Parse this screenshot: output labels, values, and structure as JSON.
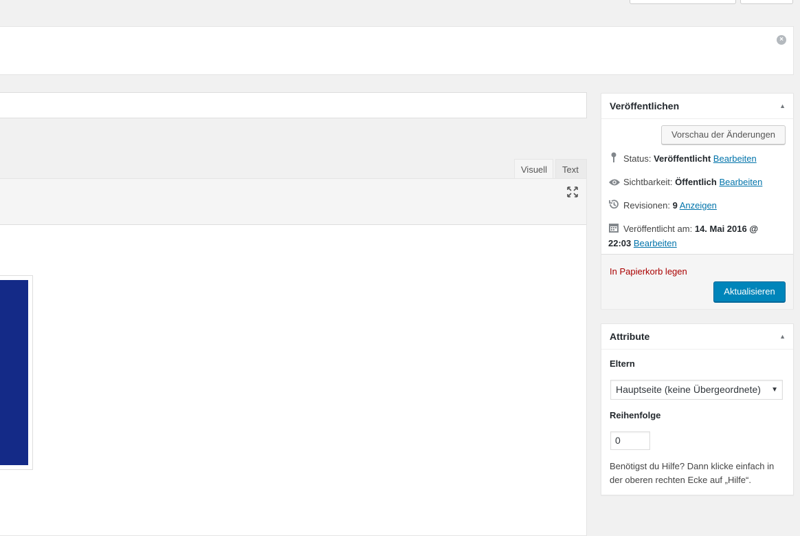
{
  "editor": {
    "tabs": [
      {
        "label": "Visuell"
      },
      {
        "label": "Text"
      }
    ]
  },
  "publish": {
    "title": "Veröffentlichen",
    "preview_label": "Vorschau der Änderungen",
    "status_label": "Status:",
    "status_value": "Veröffentlicht",
    "visibility_label": "Sichtbarkeit:",
    "visibility_value": "Öffentlich",
    "revisions_label": "Revisionen:",
    "revisions_value": "9",
    "revisions_link": "Anzeigen",
    "published_label": "Veröffentlicht am:",
    "published_date": "14. Mai 2016 @",
    "published_time": "22:03",
    "edit_link": "Bearbeiten",
    "trash_label": "In Papierkorb legen",
    "update_label": "Aktualisieren"
  },
  "attributes": {
    "title": "Attribute",
    "parent_label": "Eltern",
    "parent_selected": "Hauptseite (keine Übergeordnete)",
    "order_label": "Reihenfolge",
    "order_value": "0",
    "help_text": "Benötigst du Hilfe? Dann klicke einfach in der oberen rechten Ecke auf „Hilfe“."
  },
  "colors": {
    "primary_button": "#0085ba",
    "trash_link": "#aa0000",
    "image_fill": "#142a87"
  }
}
